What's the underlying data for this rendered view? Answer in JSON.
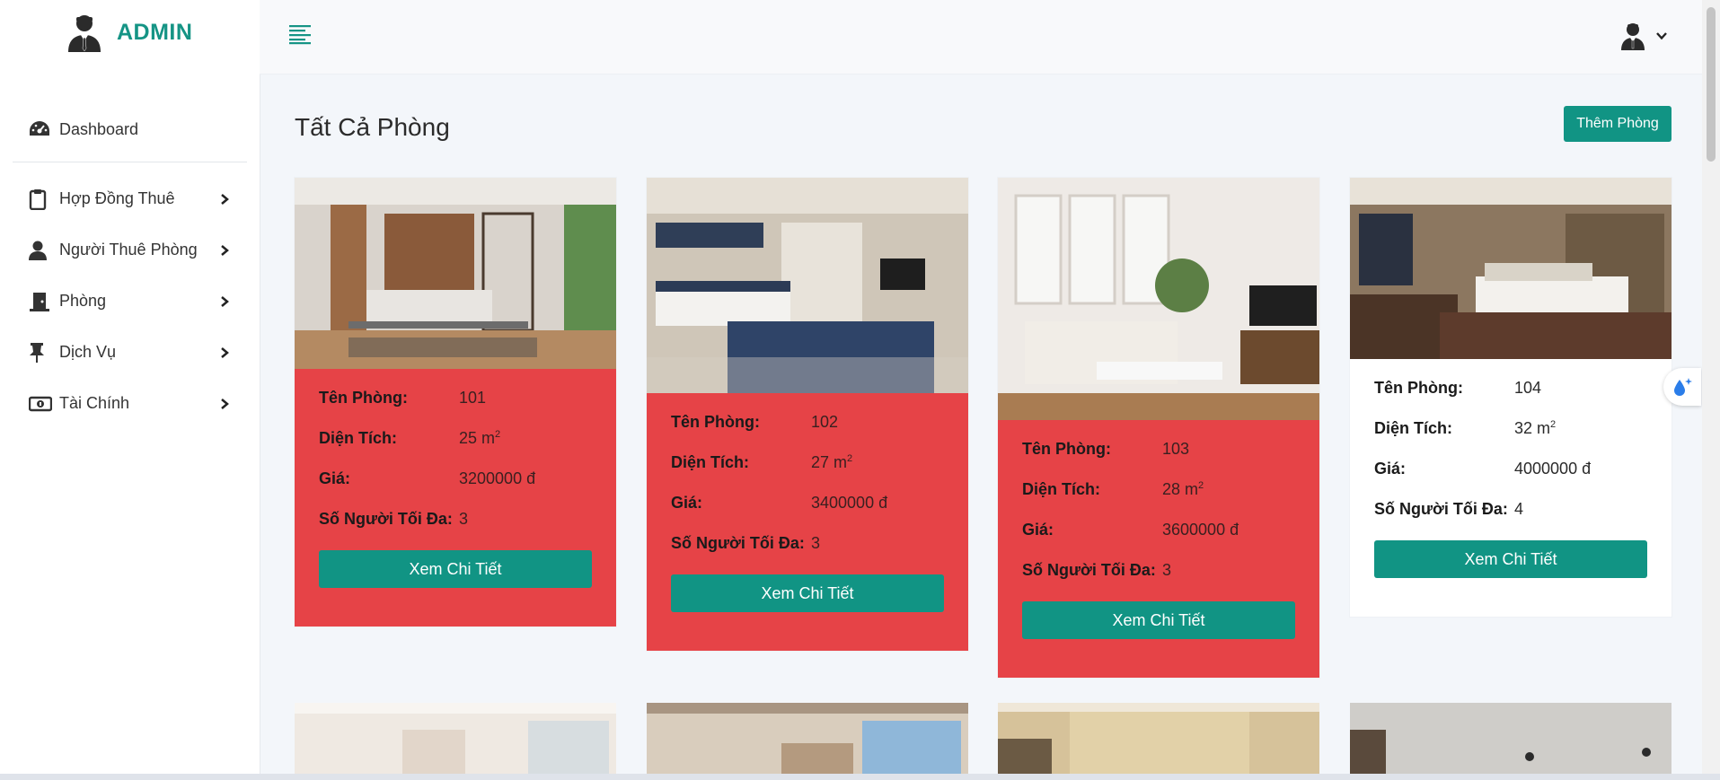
{
  "brand": {
    "title": "ADMIN",
    "icon": "admin-user-icon"
  },
  "sidebar": {
    "items": [
      {
        "label": "Dashboard",
        "icon": "speedometer-icon"
      },
      {
        "label": "Hợp Đồng Thuê",
        "icon": "clipboard-icon"
      },
      {
        "label": "Người Thuê Phòng",
        "icon": "person-icon"
      },
      {
        "label": "Phòng",
        "icon": "door-icon"
      },
      {
        "label": "Dịch Vụ",
        "icon": "pin-icon"
      },
      {
        "label": "Tài Chính",
        "icon": "money-icon"
      }
    ]
  },
  "header": {
    "user_icon": "user-avatar-icon",
    "caret": "chevron-down-icon"
  },
  "main": {
    "title": "Tất Cả Phòng",
    "add_button": "Thêm Phòng"
  },
  "labels": {
    "name": "Tên Phòng:",
    "area": "Diện Tích:",
    "price": "Giá:",
    "max_people": "Số Người Tối Đa:",
    "area_unit": "m",
    "area_sup": "2",
    "currency": "đ",
    "detail_button": "Xem Chi Tiết"
  },
  "rooms": [
    {
      "name": "101",
      "area": "25",
      "price": "3200000",
      "max_people": "3",
      "status_color": "#e64347"
    },
    {
      "name": "102",
      "area": "27",
      "price": "3400000",
      "max_people": "3",
      "status_color": "#e64347"
    },
    {
      "name": "103",
      "area": "28",
      "price": "3600000",
      "max_people": "3",
      "status_color": "#e64347"
    },
    {
      "name": "104",
      "area": "32",
      "price": "4000000",
      "max_people": "4",
      "status_color": "#ffffff"
    }
  ],
  "colors": {
    "accent": "#119484",
    "occupied": "#e64347",
    "available": "#ffffff"
  }
}
